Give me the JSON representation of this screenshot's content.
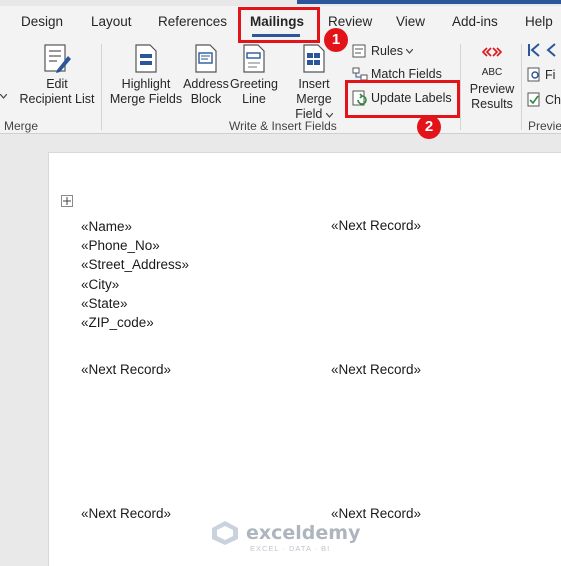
{
  "tabs": [
    "Design",
    "Layout",
    "References",
    "Mailings",
    "Review",
    "View",
    "Add-ins",
    "Help"
  ],
  "active_tab": "Mailings",
  "ribbon": {
    "edit_recipient_list": [
      "Edit",
      "Recipient List"
    ],
    "highlight_merge_fields": [
      "Highlight",
      "Merge Fields"
    ],
    "address_block": [
      "Address",
      "Block"
    ],
    "greeting_line": [
      "Greeting",
      "Line"
    ],
    "insert_merge_field": [
      "Insert Merge",
      "Field"
    ],
    "rules": "Rules",
    "match_fields": "Match Fields",
    "update_labels": "Update Labels",
    "preview_abc": "ABC",
    "preview_results": [
      "Preview",
      "Results"
    ],
    "find_recipient": "Fi",
    "check_errors": "Ch",
    "groups": {
      "start_merge": "Merge",
      "write_insert": "Write & Insert Fields",
      "preview": "Previe"
    }
  },
  "document": {
    "left_label_fields": [
      "«Name»",
      "«Phone_No»",
      "«Street_Address»",
      "«City»",
      "«State»",
      "«ZIP_code»"
    ],
    "next_record": "«Next Record»"
  },
  "annotations": {
    "step1": "1",
    "step2": "2"
  },
  "watermark": {
    "brand": "exceldemy",
    "tagline": "EXCEL · DATA · BI"
  },
  "colors": {
    "accent_blue": "#2b579a",
    "annotation_red": "#e3131a",
    "ribbon_bg": "#f3f3f3"
  }
}
